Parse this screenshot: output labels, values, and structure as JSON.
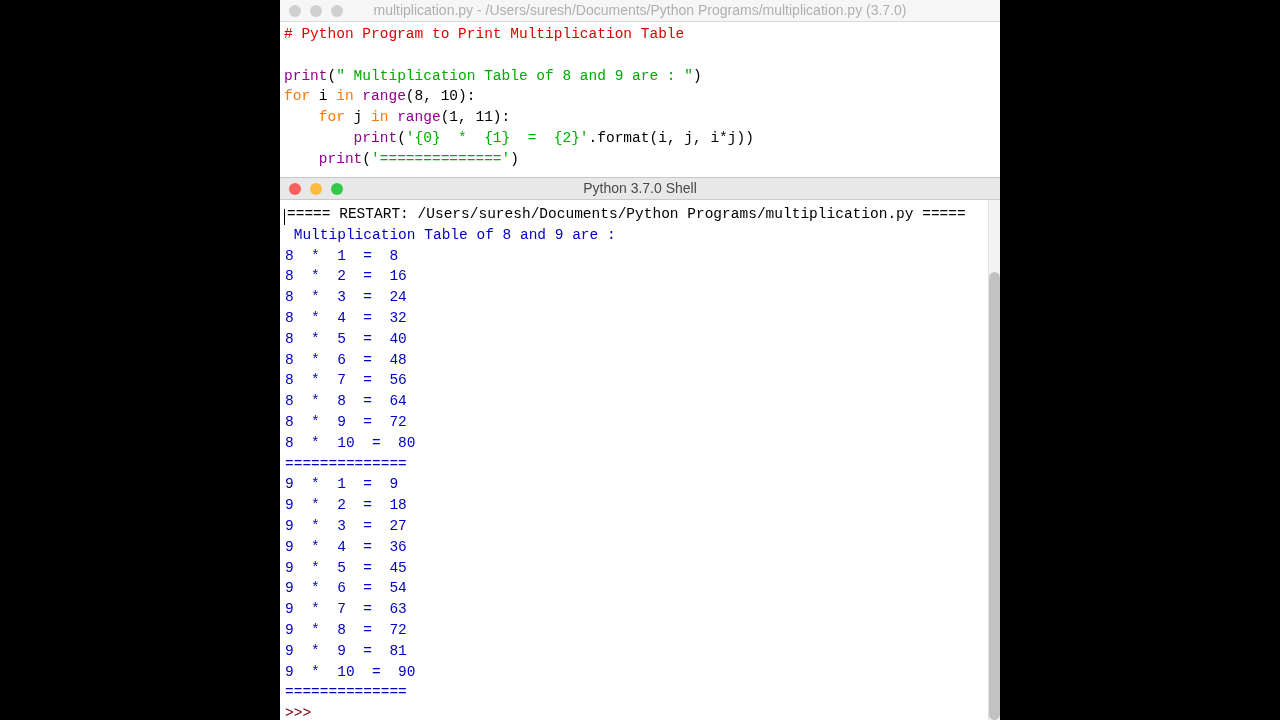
{
  "editor": {
    "title": "multiplication.py - /Users/suresh/Documents/Python Programs/multiplication.py (3.7.0)",
    "lines": [
      {
        "kind": "code",
        "tokens": [
          {
            "kind": "comment",
            "text": "# Python Program to Print Multiplication Table"
          }
        ]
      },
      {
        "kind": "blank"
      },
      {
        "kind": "code",
        "tokens": [
          {
            "kind": "builtin",
            "text": "print"
          },
          {
            "kind": "plain",
            "text": "("
          },
          {
            "kind": "string",
            "text": "\" Multiplication Table of 8 and 9 are : \""
          },
          {
            "kind": "plain",
            "text": ")"
          }
        ]
      },
      {
        "kind": "code",
        "tokens": [
          {
            "kind": "keyword",
            "text": "for"
          },
          {
            "kind": "plain",
            "text": " i "
          },
          {
            "kind": "keyword",
            "text": "in"
          },
          {
            "kind": "builtin",
            "text": " range"
          },
          {
            "kind": "plain",
            "text": "(8, 10):"
          }
        ]
      },
      {
        "kind": "code",
        "tokens": [
          {
            "kind": "keyword",
            "text": "    for"
          },
          {
            "kind": "plain",
            "text": " j "
          },
          {
            "kind": "keyword",
            "text": "in"
          },
          {
            "kind": "builtin",
            "text": " range"
          },
          {
            "kind": "plain",
            "text": "(1, 11):"
          }
        ]
      },
      {
        "kind": "code",
        "tokens": [
          {
            "kind": "builtin",
            "text": "        print"
          },
          {
            "kind": "plain",
            "text": "("
          },
          {
            "kind": "string",
            "text": "'{0}  *  {1}  =  {2}'"
          },
          {
            "kind": "plain",
            "text": ".format(i, j, i*j))"
          }
        ]
      },
      {
        "kind": "code",
        "tokens": [
          {
            "kind": "builtin",
            "text": "    print"
          },
          {
            "kind": "plain",
            "text": "("
          },
          {
            "kind": "string",
            "text": "'=============='"
          },
          {
            "kind": "plain",
            "text": ")"
          }
        ]
      }
    ]
  },
  "shell": {
    "title": "Python 3.7.0 Shell",
    "lines": [
      {
        "kind": "restart",
        "text": "===== RESTART: /Users/suresh/Documents/Python Programs/multiplication.py ====="
      },
      {
        "kind": "output",
        "text": " Multiplication Table of 8 and 9 are : "
      },
      {
        "kind": "output",
        "text": "8  *  1  =  8"
      },
      {
        "kind": "output",
        "text": "8  *  2  =  16"
      },
      {
        "kind": "output",
        "text": "8  *  3  =  24"
      },
      {
        "kind": "output",
        "text": "8  *  4  =  32"
      },
      {
        "kind": "output",
        "text": "8  *  5  =  40"
      },
      {
        "kind": "output",
        "text": "8  *  6  =  48"
      },
      {
        "kind": "output",
        "text": "8  *  7  =  56"
      },
      {
        "kind": "output",
        "text": "8  *  8  =  64"
      },
      {
        "kind": "output",
        "text": "8  *  9  =  72"
      },
      {
        "kind": "output",
        "text": "8  *  10  =  80"
      },
      {
        "kind": "output",
        "text": "=============="
      },
      {
        "kind": "output",
        "text": "9  *  1  =  9"
      },
      {
        "kind": "output",
        "text": "9  *  2  =  18"
      },
      {
        "kind": "output",
        "text": "9  *  3  =  27"
      },
      {
        "kind": "output",
        "text": "9  *  4  =  36"
      },
      {
        "kind": "output",
        "text": "9  *  5  =  45"
      },
      {
        "kind": "output",
        "text": "9  *  6  =  54"
      },
      {
        "kind": "output",
        "text": "9  *  7  =  63"
      },
      {
        "kind": "output",
        "text": "9  *  8  =  72"
      },
      {
        "kind": "output",
        "text": "9  *  9  =  81"
      },
      {
        "kind": "output",
        "text": "9  *  10  =  90"
      },
      {
        "kind": "output",
        "text": "=============="
      },
      {
        "kind": "prompt",
        "text": ">>>"
      }
    ]
  }
}
